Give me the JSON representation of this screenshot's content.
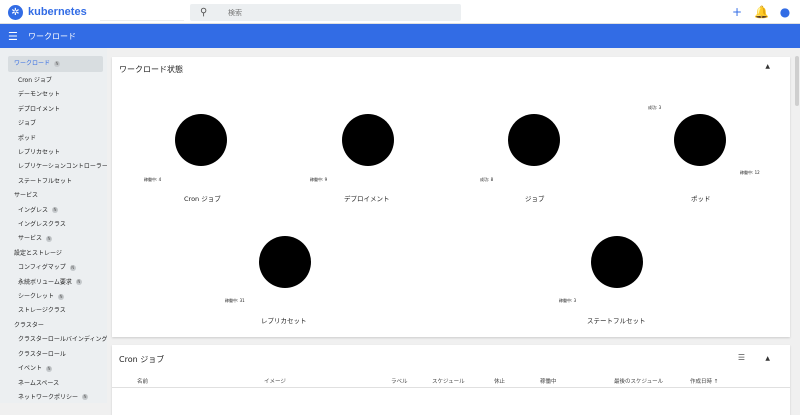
{
  "topbar": {
    "brand": "kubernetes",
    "search_placeholder": "検索",
    "icons": [
      "plus-icon",
      "bell-icon",
      "account-icon"
    ]
  },
  "header": {
    "title": "ワークロード"
  },
  "sidebar": {
    "sections": [
      {
        "label": "ワークロード",
        "badge": "N",
        "active": true,
        "items": [
          {
            "label": "Cron ジョブ"
          },
          {
            "label": "デーモンセット"
          },
          {
            "label": "デプロイメント"
          },
          {
            "label": "ジョブ"
          },
          {
            "label": "ポッド"
          },
          {
            "label": "レプリカセット"
          },
          {
            "label": "レプリケーションコントローラー"
          },
          {
            "label": "ステートフルセット"
          }
        ]
      },
      {
        "label": "サービス",
        "items": [
          {
            "label": "イングレス",
            "badge": "N"
          },
          {
            "label": "イングレスクラス"
          },
          {
            "label": "サービス",
            "badge": "N"
          }
        ]
      },
      {
        "label": "設定とストレージ",
        "items": [
          {
            "label": "コンフィグマップ",
            "badge": "N"
          },
          {
            "label": "永続ボリューム要求",
            "badge": "N"
          },
          {
            "label": "シークレット",
            "badge": "N"
          },
          {
            "label": "ストレージクラス"
          }
        ]
      },
      {
        "label": "クラスター",
        "items": [
          {
            "label": "クラスターロールバインディング"
          },
          {
            "label": "クラスターロール"
          },
          {
            "label": "イベント",
            "badge": "N"
          },
          {
            "label": "ネームスペース"
          },
          {
            "label": "ネットワークポリシー",
            "badge": "N"
          }
        ]
      }
    ]
  },
  "status_panel": {
    "title": "ワークロード状態",
    "charts": [
      {
        "title": "Cron ジョブ",
        "labels": [
          "稼働中: 4"
        ]
      },
      {
        "title": "デプロイメント",
        "labels": [
          "稼働中: 9"
        ]
      },
      {
        "title": "ジョブ",
        "labels": [
          "成功: 8"
        ]
      },
      {
        "title": "ポッド",
        "labels": [
          "成功: 3",
          "稼働中: 12"
        ]
      },
      {
        "title": "レプリカセット",
        "labels": [
          "稼働中: 31"
        ]
      },
      {
        "title": "ステートフルセット",
        "labels": [
          "稼働中: 3"
        ]
      }
    ]
  },
  "cron_panel": {
    "title": "Cron ジョブ",
    "columns": [
      "名前",
      "イメージ",
      "ラベル",
      "スケジュール",
      "休止",
      "稼働中",
      "最後のスケジュール",
      "作成日時"
    ]
  },
  "colors": {
    "brand": "#326ce5",
    "donut": "#000000",
    "sidebar_bg": "#eceff1"
  }
}
